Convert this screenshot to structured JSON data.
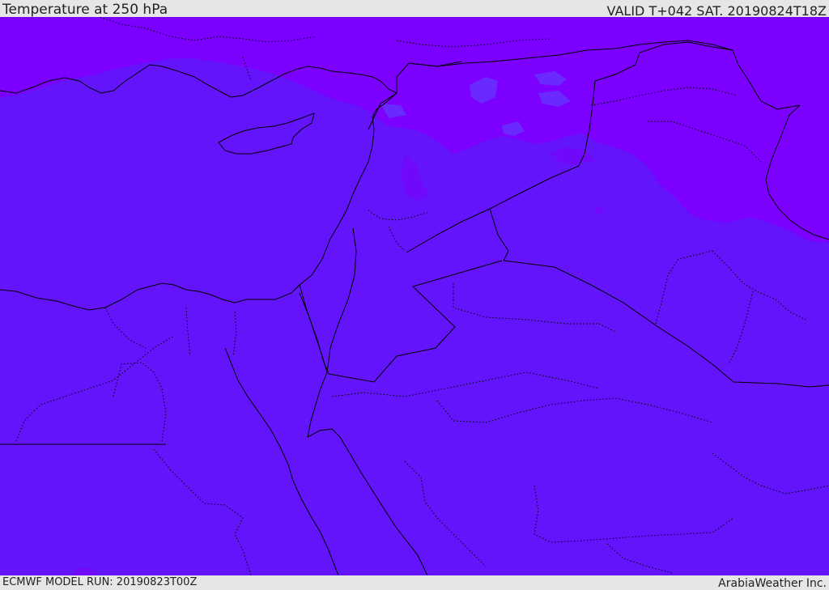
{
  "header": {
    "title": "Temperature at 250 hPa",
    "valid_time": "VALID T+042 SAT. 20190824T18Z"
  },
  "footer": {
    "model_run": "ECMWF MODEL RUN: 20190823T00Z",
    "credit": "ArabiaWeather Inc."
  },
  "map": {
    "parameter": "temperature",
    "pressure_level": "250 hPa",
    "colors": {
      "field_primary": "#6414fa",
      "field_cold": "#7c00ff",
      "field_mid": "#7008fc",
      "field_blue_patch": "#6a2aff",
      "coastline": "#000000",
      "border": "#000000"
    },
    "border_style": {
      "national": "solid",
      "internal": "dotted"
    }
  }
}
